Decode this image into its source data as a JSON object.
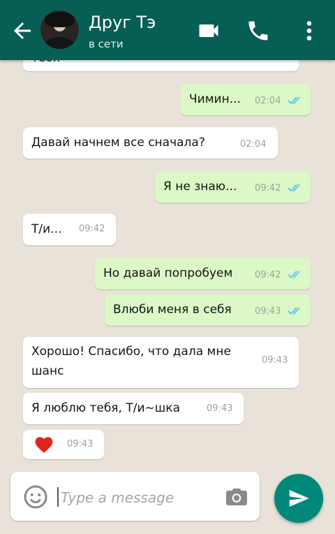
{
  "contact": {
    "name": "Друг Тэ",
    "status": "в сети"
  },
  "messages": [
    {
      "dir": "in",
      "text": "тебя",
      "time": ""
    },
    {
      "dir": "out",
      "text": "Чимин...",
      "time": "02:04",
      "read": true
    },
    {
      "dir": "in",
      "text": "Давай начнем все сначала?",
      "time": "02:04"
    },
    {
      "dir": "out",
      "text": "Я не знаю...",
      "time": "09:42",
      "read": true
    },
    {
      "dir": "in",
      "text": "Т/и...",
      "time": "09:42"
    },
    {
      "dir": "out",
      "text": "Но давай попробуем",
      "time": "09:42",
      "read": true
    },
    {
      "dir": "out",
      "text": "Влюби меня в себя",
      "time": "09:43",
      "read": true
    },
    {
      "dir": "in",
      "text_line1": "Хорошо! Спасибо, что дала мне",
      "text_line2": "шанс",
      "time": "09:43"
    },
    {
      "dir": "in",
      "text": "Я люблю тебя, Т/и~шка",
      "time": "09:43"
    },
    {
      "dir": "in",
      "emoji": "❤️",
      "time": "09:43"
    }
  ],
  "composer": {
    "placeholder": "Type a message"
  },
  "colors": {
    "header": "#075e54",
    "outgoing": "#dcf8c6",
    "incoming": "#ffffff",
    "send": "#00897b",
    "ticks": "#4fc3f7"
  },
  "icons": [
    "back-arrow-icon",
    "video-call-icon",
    "phone-icon",
    "menu-dots-icon",
    "emoji-icon",
    "camera-icon",
    "send-icon",
    "read-ticks-icon"
  ]
}
